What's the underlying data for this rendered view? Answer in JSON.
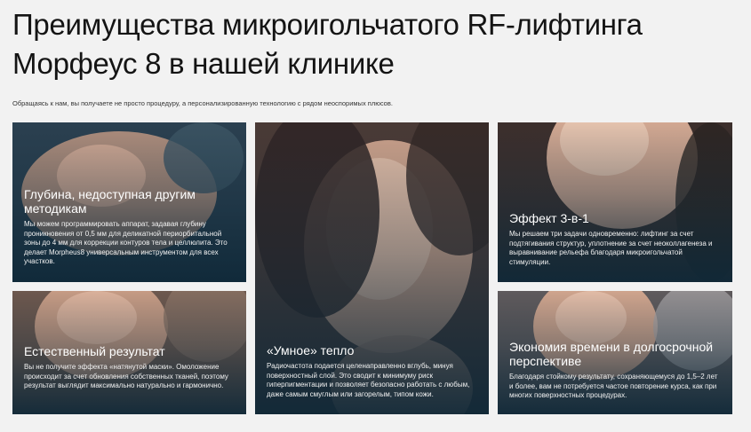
{
  "header": {
    "title": "Преимущества микроигольчатого RF-лифтинга Морфеус 8 в нашей клинике",
    "intro": "Обращаясь к нам, вы получаете не просто процедуру, а персонализированную технологию с рядом неоспоримых плюсов."
  },
  "cards": [
    {
      "title": "Глубина, недоступная другим методикам",
      "text": "Мы можем программировать аппарат, задавая глубину проникновения от 0,5 мм для деликатной периорбитальной зоны до 4 мм для коррекции контуров тела и целлюлита. Это делает Morpheus8 универсальным инструментом для всех участков."
    },
    {
      "title": "«Умное» тепло",
      "text": "Радиочастота подается целенаправленно вглубь, минуя поверхностный слой. Это сводит к минимуму риск гиперпигментации и позволяет безопасно работать с любым, даже самым смуглым или загорелым, типом кожи."
    },
    {
      "title": "Эффект 3-в-1",
      "text": "Мы решаем три задачи одновременно: лифтинг за счет подтягивания структур, уплотнение за счет неоколлагенеза и выравнивание рельефа благодаря микроигольчатой стимуляции."
    },
    {
      "title": "Естественный результат",
      "text": "Вы не получите эффекта «натянутой маски». Омоложение происходит за счет обновления собственных тканей, поэтому результат выглядит максимально натурально и гармонично."
    },
    {
      "title": "Экономия времени в долгосрочной перспективе",
      "text": "Благодаря стойкому результату, сохраняющемуся до 1,5–2 лет и более, вам не потребуется частое повторение курса, как при многих поверхностных процедурах."
    }
  ]
}
